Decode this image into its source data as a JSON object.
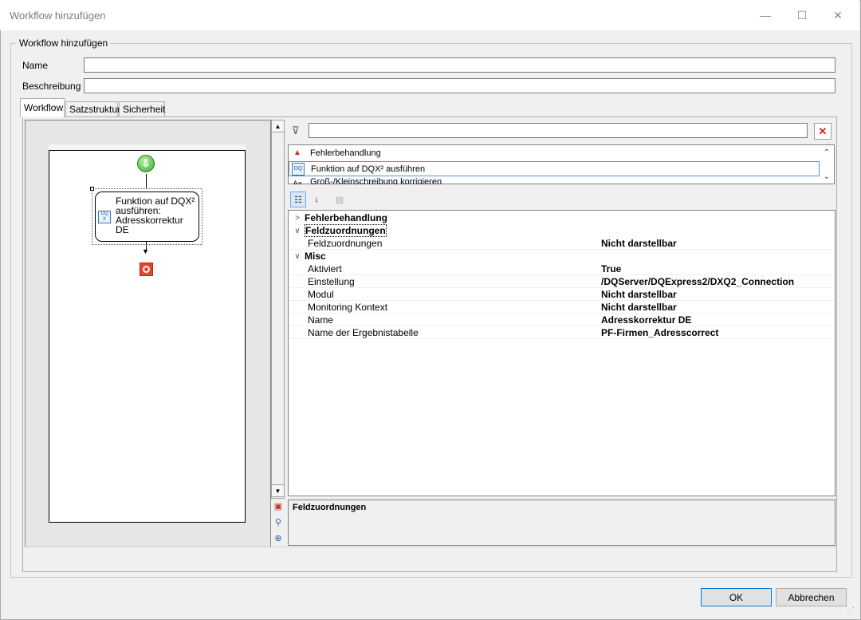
{
  "window": {
    "title": "Workflow hinzufügen",
    "minimize_glyph": "—",
    "maximize_glyph": "☐",
    "close_glyph": "✕"
  },
  "groupbox": {
    "label": "Workflow hinzufügen"
  },
  "fields": {
    "name_label": "Name",
    "name_value": "",
    "description_label": "Beschreibung",
    "description_value": ""
  },
  "tabs": [
    {
      "label": "Workflow",
      "active": true
    },
    {
      "label": "Satzstruktur",
      "active": false
    },
    {
      "label": "Sicherheit",
      "active": false
    }
  ],
  "designer": {
    "activity_label": "Funktion auf DQX² ausführen: Adresskorrektur DE",
    "start_icon": "arrow-down-circle-icon",
    "end_icon": "stop-icon"
  },
  "filter": {
    "value": ""
  },
  "activity_list": [
    {
      "label": "Fehlerbehandlung",
      "icon": "warning-icon"
    },
    {
      "label": "Funktion auf DQX² ausführen",
      "icon": "dqx-icon"
    },
    {
      "label": "Groß-/Kleinschreibung korrigieren",
      "icon": "text-case-icon"
    }
  ],
  "propgrid": {
    "categories": {
      "fehler": "Fehlerbehandlung",
      "feldzuordnungen": "Feldzuordnungen",
      "misc": "Misc"
    },
    "rows": [
      {
        "name": "Feldzuordnungen",
        "value": "Nicht darstellbar"
      },
      {
        "name": "Aktiviert",
        "value": "True"
      },
      {
        "name": "Einstellung",
        "value": "/DQServer/DQExpress2/DXQ2_Connection"
      },
      {
        "name": "Modul",
        "value": "Nicht darstellbar"
      },
      {
        "name": "Monitoring Kontext",
        "value": "Nicht darstellbar"
      },
      {
        "name": "Name",
        "value": "Adresskorrektur DE"
      },
      {
        "name": "Name der Ergebnistabelle",
        "value": "PF-Firmen_Adresscorrect"
      }
    ],
    "description_title": "Feldzuordnungen"
  },
  "buttons": {
    "ok": "OK",
    "cancel": "Abbrechen"
  }
}
